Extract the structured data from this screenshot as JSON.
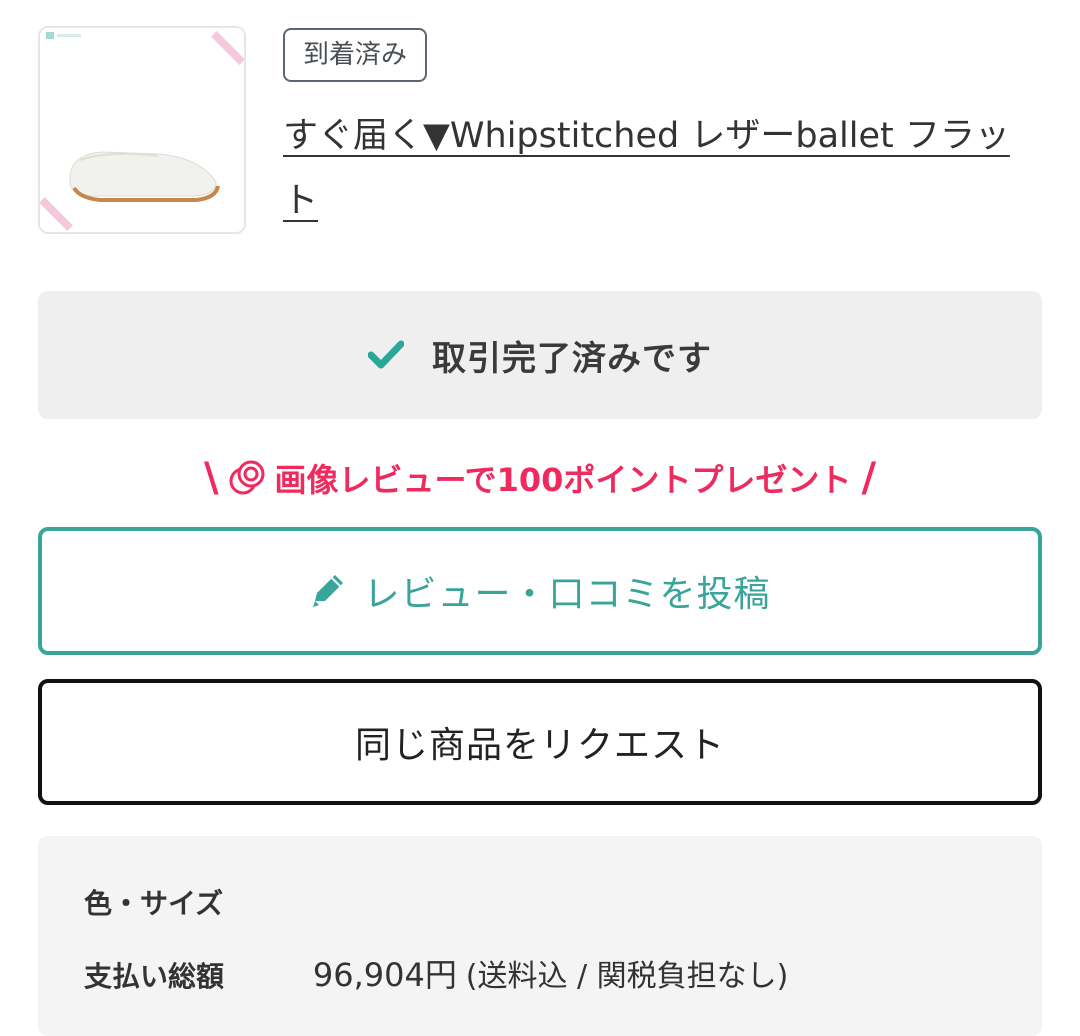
{
  "product": {
    "status_badge": "到着済み",
    "title": "すぐ届く▼Whipstitched レザーballet フラット"
  },
  "transaction": {
    "complete_label": "取引完了済みです"
  },
  "promo": {
    "left_mark": "\\",
    "text": "画像レビューで100ポイントプレゼント",
    "right_mark": "/"
  },
  "actions": {
    "review_label": "レビュー・口コミを投稿",
    "request_label": "同じ商品をリクエスト"
  },
  "details": {
    "color_size_label": "色・サイズ",
    "total_label": "支払い総額",
    "total_value": "96,904円",
    "total_note": "(送料込 / 関税負担なし)"
  },
  "colors": {
    "accent_teal": "#39a59a",
    "promo_pink": "#ee2a5f",
    "check_teal": "#2ba79a"
  },
  "icons": {
    "check": "check-icon",
    "coin": "coin-stack-icon",
    "pencil": "pencil-icon"
  }
}
